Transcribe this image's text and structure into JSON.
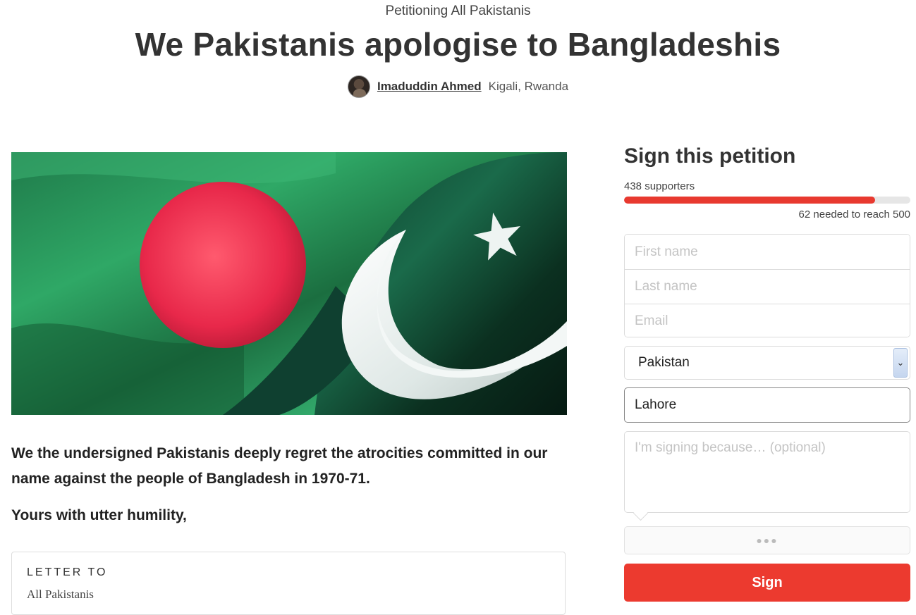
{
  "header": {
    "petitioning": "Petitioning All Pakistanis",
    "title": "We Pakistanis apologise to Bangladeshis",
    "author_name": "Imaduddin Ahmed",
    "author_location": "Kigali, Rwanda"
  },
  "petition": {
    "body": "We the undersigned Pakistanis deeply regret the atrocities committed in our name against the people of Bangladesh in 1970-71.",
    "signoff": "Yours with utter humility,",
    "letter_to_label": "LETTER TO",
    "letter_recipient": "All Pakistanis"
  },
  "sign_panel": {
    "title": "Sign this petition",
    "supporters_text": "438 supporters",
    "needed_text": "62 needed to reach 500",
    "progress_fraction": 0.876,
    "progress_color": "#e8392f",
    "first_name_placeholder": "First name",
    "last_name_placeholder": "Last name",
    "email_placeholder": "Email",
    "country_value": "Pakistan",
    "city_value": "Lahore",
    "reason_placeholder": "I'm signing because… (optional)",
    "captcha_dots": "●●●",
    "sign_label": "Sign",
    "sign_color": "#ec3a2f"
  },
  "icons": {
    "select_arrow": "chevron-down-icon",
    "avatar": "avatar"
  }
}
